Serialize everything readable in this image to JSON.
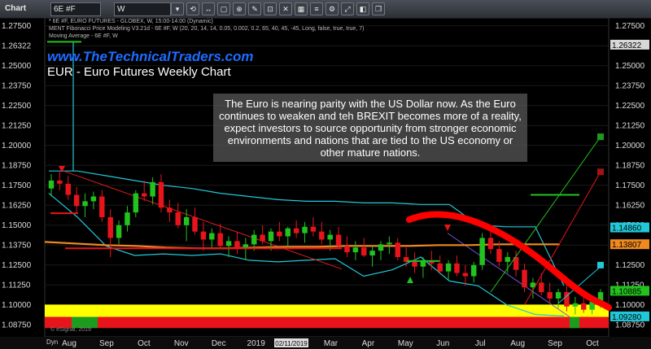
{
  "toolbar": {
    "app_label": "Chart",
    "symbol": "6E #F",
    "interval": "W",
    "buttons": [
      "▾",
      "⟲",
      "↔",
      "▢",
      "⊕",
      "✎",
      "⊡",
      "✕",
      "▦",
      "≡",
      "⚙",
      "⤢",
      "◧",
      "❐"
    ]
  },
  "study_lines": {
    "line1": "* 6E #F, EURO FUTURES - GLOBEX, W, 15:00-14:00 (Dynamic)",
    "line2": "MENT Fibonacci Price Modeling V3.21d - 6E #F, W (20, 20, 14, 14, 0.05, 0.002, 0.2, 65, 40, 45, -45, Long, false, true, true, 7)",
    "line3": "Moving Average - 6E #F, W"
  },
  "site_url": "www.TheTechnicalTraders.com",
  "chart_title": "EUR - Euro Futures Weekly Chart",
  "overlay_text": "The Euro is nearing parity with the US Dollar now. As the Euro continues to weaken and teh BREXIT becomes more of a reality, expect investors to source opportunity from stronger economic environments and nations that are tied to the US economy or other mature nations.",
  "copyright": "© eSignal, 2019",
  "dyn_label": "Dyn",
  "cursor_date_label": "02/11/2019",
  "colors": {
    "up": "#22c31e",
    "down": "#e8141c",
    "moving_average": "#f08a20",
    "envelope": "#22c8d8",
    "trend": "#d41c1c",
    "projection": "#ff0000",
    "yellow_band": "#ffff00"
  },
  "chart_data": {
    "type": "candlestick",
    "title": "EUR - Euro Futures Weekly Chart",
    "ylim": [
      1.08,
      1.28
    ],
    "y_ticks": [
      1.275,
      1.2625,
      1.25,
      1.2375,
      1.225,
      1.2125,
      1.2,
      1.1875,
      1.175,
      1.1625,
      1.15,
      1.1375,
      1.125,
      1.1125,
      1.1,
      1.0875
    ],
    "y_tick_labels": [
      "1.27500",
      "1.26322",
      "1.25000",
      "1.23750",
      "1.22500",
      "1.21250",
      "1.20000",
      "1.18750",
      "1.17500",
      "1.16250",
      "1.15000",
      "1.13750",
      "1.12500",
      "1.11250",
      "1.10000",
      "1.08750"
    ],
    "right_ticks": [
      "1.27500",
      "1.26322",
      "1.25000",
      "1.23750",
      "1.22500",
      "1.21250",
      "1.20000",
      "1.18750",
      "1.17500",
      "1.16250",
      "1.15000",
      "1.13750",
      "1.12500",
      "1.11250",
      "1.10000",
      "1.08750"
    ],
    "x_labels": [
      "Aug",
      "Sep",
      "Oct",
      "Nov",
      "Dec",
      "2019",
      "Feb",
      "Mar",
      "Apr",
      "May",
      "Jun",
      "Jul",
      "Aug",
      "Sep",
      "Oct"
    ],
    "price_tags": [
      {
        "value": 1.26322,
        "label": "1.26322",
        "color": "#d8d8d8"
      },
      {
        "value": 1.1486,
        "label": "1.14860",
        "color": "#22c8d8"
      },
      {
        "value": 1.13807,
        "label": "1.13807",
        "color": "#f08a20"
      },
      {
        "value": 1.10885,
        "label": "1.10885",
        "color": "#22c31e"
      },
      {
        "value": 1.0928,
        "label": "1.09280",
        "color": "#22c8d8"
      }
    ],
    "candles": [
      [
        1.173,
        1.182,
        1.168,
        1.178
      ],
      [
        1.178,
        1.184,
        1.172,
        1.176
      ],
      [
        1.176,
        1.181,
        1.166,
        1.169
      ],
      [
        1.169,
        1.174,
        1.158,
        1.162
      ],
      [
        1.162,
        1.17,
        1.155,
        1.165
      ],
      [
        1.165,
        1.171,
        1.16,
        1.168
      ],
      [
        1.168,
        1.172,
        1.152,
        1.155
      ],
      [
        1.155,
        1.16,
        1.13,
        1.142
      ],
      [
        1.142,
        1.153,
        1.138,
        1.15
      ],
      [
        1.15,
        1.162,
        1.146,
        1.158
      ],
      [
        1.158,
        1.172,
        1.155,
        1.17
      ],
      [
        1.17,
        1.178,
        1.165,
        1.168
      ],
      [
        1.168,
        1.18,
        1.163,
        1.177
      ],
      [
        1.177,
        1.182,
        1.158,
        1.161
      ],
      [
        1.161,
        1.166,
        1.152,
        1.158
      ],
      [
        1.158,
        1.164,
        1.148,
        1.15
      ],
      [
        1.15,
        1.16,
        1.14,
        1.155
      ],
      [
        1.155,
        1.161,
        1.144,
        1.146
      ],
      [
        1.146,
        1.152,
        1.134,
        1.141
      ],
      [
        1.141,
        1.148,
        1.136,
        1.145
      ],
      [
        1.145,
        1.151,
        1.135,
        1.137
      ],
      [
        1.137,
        1.143,
        1.13,
        1.14
      ],
      [
        1.14,
        1.146,
        1.132,
        1.135
      ],
      [
        1.135,
        1.142,
        1.128,
        1.138
      ],
      [
        1.138,
        1.147,
        1.134,
        1.144
      ],
      [
        1.144,
        1.15,
        1.138,
        1.14
      ],
      [
        1.14,
        1.148,
        1.134,
        1.146
      ],
      [
        1.146,
        1.152,
        1.14,
        1.143
      ],
      [
        1.143,
        1.149,
        1.136,
        1.148
      ],
      [
        1.148,
        1.153,
        1.142,
        1.145
      ],
      [
        1.145,
        1.152,
        1.139,
        1.149
      ],
      [
        1.149,
        1.155,
        1.143,
        1.146
      ],
      [
        1.146,
        1.152,
        1.138,
        1.141
      ],
      [
        1.141,
        1.147,
        1.134,
        1.144
      ],
      [
        1.144,
        1.149,
        1.136,
        1.137
      ],
      [
        1.137,
        1.143,
        1.13,
        1.133
      ],
      [
        1.133,
        1.14,
        1.128,
        1.136
      ],
      [
        1.136,
        1.142,
        1.13,
        1.131
      ],
      [
        1.131,
        1.137,
        1.124,
        1.134
      ],
      [
        1.134,
        1.14,
        1.128,
        1.138
      ],
      [
        1.138,
        1.143,
        1.132,
        1.139
      ],
      [
        1.139,
        1.142,
        1.128,
        1.13
      ],
      [
        1.13,
        1.136,
        1.124,
        1.127
      ],
      [
        1.127,
        1.133,
        1.12,
        1.124
      ],
      [
        1.124,
        1.13,
        1.117,
        1.128
      ],
      [
        1.128,
        1.134,
        1.122,
        1.126
      ],
      [
        1.126,
        1.131,
        1.119,
        1.121
      ],
      [
        1.121,
        1.128,
        1.116,
        1.126
      ],
      [
        1.126,
        1.131,
        1.118,
        1.12
      ],
      [
        1.12,
        1.125,
        1.112,
        1.118
      ],
      [
        1.118,
        1.127,
        1.114,
        1.125
      ],
      [
        1.125,
        1.145,
        1.122,
        1.142
      ],
      [
        1.142,
        1.148,
        1.132,
        1.135
      ],
      [
        1.135,
        1.14,
        1.124,
        1.127
      ],
      [
        1.127,
        1.133,
        1.12,
        1.13
      ],
      [
        1.13,
        1.134,
        1.118,
        1.122
      ],
      [
        1.122,
        1.126,
        1.108,
        1.111
      ],
      [
        1.111,
        1.117,
        1.104,
        1.114
      ],
      [
        1.114,
        1.12,
        1.106,
        1.108
      ],
      [
        1.108,
        1.114,
        1.101,
        1.104
      ],
      [
        1.104,
        1.11,
        1.098,
        1.108
      ],
      [
        1.108,
        1.113,
        1.096,
        1.099
      ],
      [
        1.099,
        1.105,
        1.094,
        1.101
      ],
      [
        1.101,
        1.106,
        1.095,
        1.097
      ],
      [
        1.097,
        1.104,
        1.094,
        1.102
      ],
      [
        1.102,
        1.11,
        1.098,
        1.108
      ]
    ],
    "moving_average": [
      1.1395,
      1.1385,
      1.1375,
      1.137,
      1.136,
      1.1355,
      1.1355,
      1.136,
      1.1365,
      1.1365,
      1.137,
      1.137,
      1.137,
      1.1375,
      1.1375,
      1.138,
      1.138,
      1.138
    ],
    "upper_envelope": [
      1.184,
      1.184,
      1.181,
      1.178,
      1.175,
      1.173,
      1.17,
      1.168,
      1.166,
      1.165,
      1.165,
      1.164,
      1.164,
      1.163,
      1.163,
      1.15,
      1.149,
      1.149,
      1.112
    ],
    "lower_envelope": [
      1.17,
      1.155,
      1.137,
      1.131,
      1.132,
      1.131,
      1.132,
      1.128,
      1.127,
      1.128,
      1.129,
      1.118,
      1.122,
      1.13,
      1.115,
      1.112,
      1.1,
      1.094,
      1.093
    ]
  }
}
